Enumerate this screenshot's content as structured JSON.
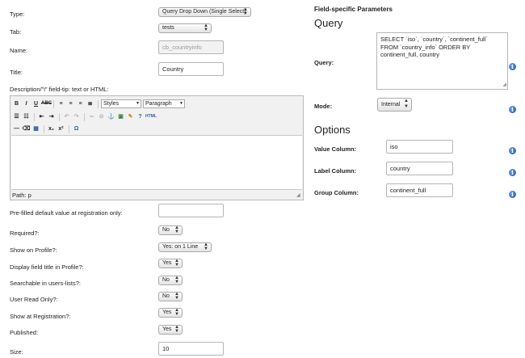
{
  "form": {
    "type_label": "Type:",
    "type_value": "Query Drop Down (Single Select)",
    "tab_label": "Tab:",
    "tab_value": "tests",
    "name_label": "Name:",
    "name_value": "cb_countryinfo",
    "title_label": "Title:",
    "title_value": "Country",
    "description_label": "Description/\"i\" field-tip: text or HTML:",
    "editor": {
      "styles_label": "Styles",
      "format_label": "Paragraph",
      "path_text": "Path: p"
    },
    "prefilled_label": "Pre-filled default value at registration only:",
    "prefilled_value": "",
    "required_label": "Required?:",
    "required_value": "No",
    "show_profile_label": "Show on Profile?:",
    "show_profile_value": "Yes: on 1 Line",
    "display_title_label": "Display field title in Profile?:",
    "display_title_value": "Yes",
    "searchable_label": "Searchable in users-lists?:",
    "searchable_value": "No",
    "readonly_label": "User Read Only?:",
    "readonly_value": "No",
    "show_registration_label": "Show at Registration?:",
    "show_registration_value": "Yes",
    "published_label": "Published:",
    "published_value": "Yes",
    "size_label": "Size:",
    "size_value": "10"
  },
  "params": {
    "heading": "Field-specific Parameters",
    "query_heading": "Query",
    "query_label": "Query:",
    "query_value": "SELECT `iso`, `country`, `continent_full` FROM `country_info` ORDER BY continent_full, country",
    "mode_label": "Mode:",
    "mode_value": "Internal",
    "options_heading": "Options",
    "value_column_label": "Value Column:",
    "value_column_value": "iso",
    "label_column_label": "Label Column:",
    "label_column_value": "country",
    "group_column_label": "Group Column:",
    "group_column_value": "continent_full",
    "info_glyph": "i"
  },
  "colors": {
    "info_icon": "#1b4fa8"
  }
}
